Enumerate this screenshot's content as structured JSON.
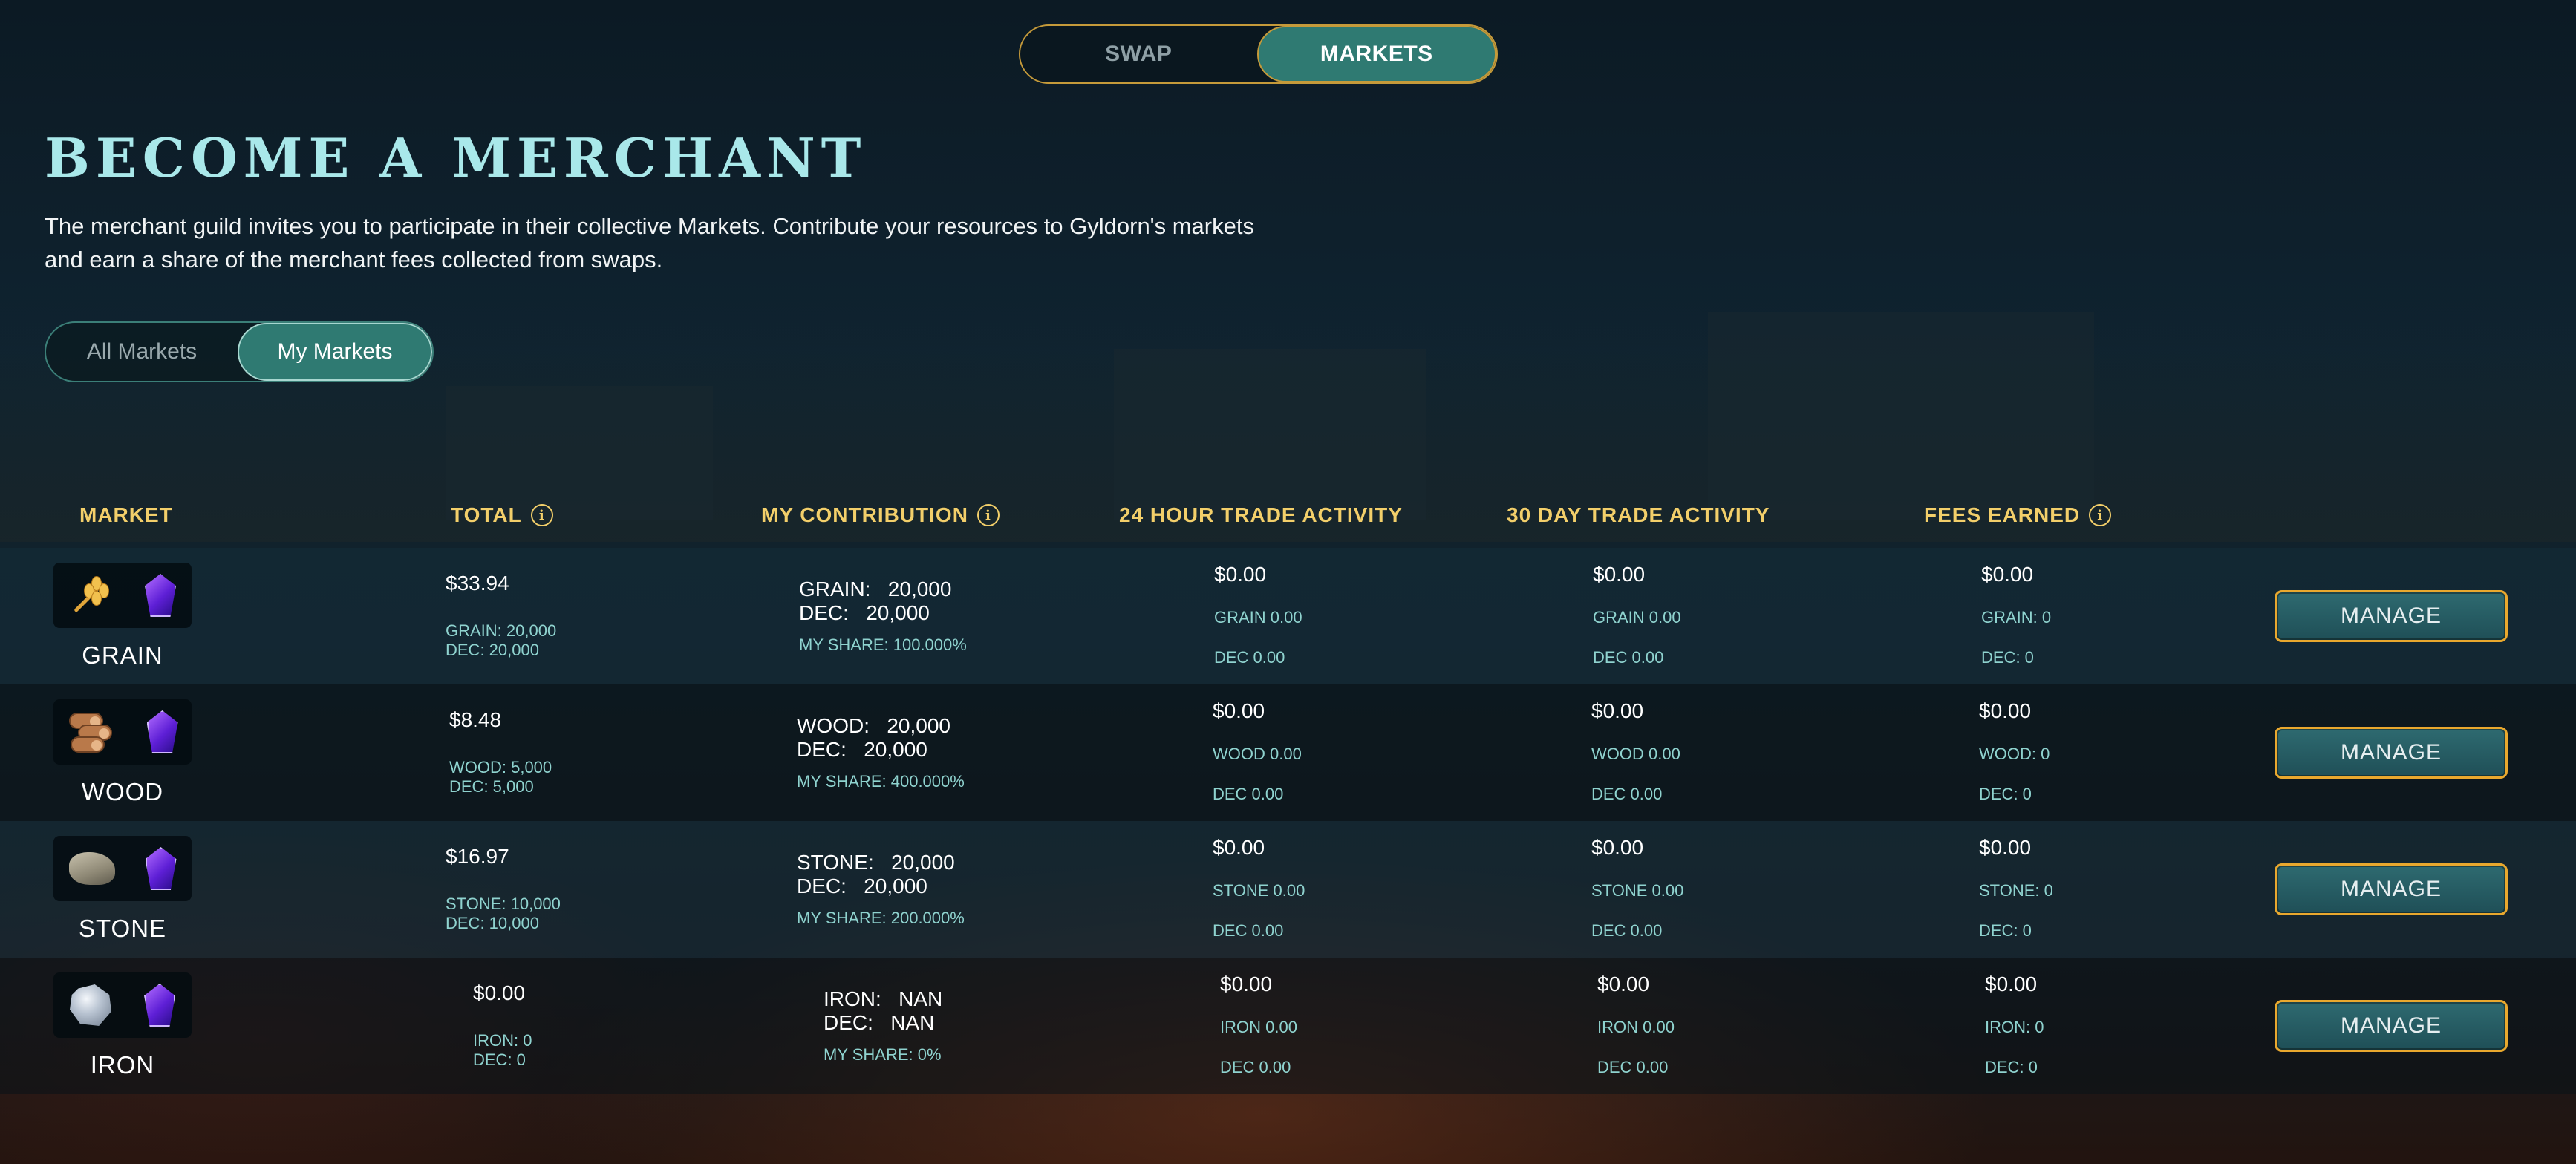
{
  "nav": {
    "tabs": [
      "SWAP",
      "MARKETS"
    ],
    "active": "MARKETS"
  },
  "page": {
    "title": "BECOME A MERCHANT",
    "intro": "The merchant guild invites you to participate in their collective Markets. Contribute your resources to Gyldorn's markets and earn a share of the merchant fees collected from swaps."
  },
  "filter": {
    "tabs": [
      "All Markets",
      "My Markets"
    ],
    "active": "My Markets"
  },
  "table": {
    "headers": {
      "market": "MARKET",
      "total": "TOTAL",
      "contribution": "MY CONTRIBUTION",
      "day24": "24 HOUR TRADE ACTIVITY",
      "day30": "30 DAY TRADE ACTIVITY",
      "fees": "FEES EARNED"
    },
    "info_icon": "i",
    "manage_label": "MANAGE",
    "rows": [
      {
        "name": "GRAIN",
        "icons": [
          "wheat-icon",
          "dec-gem-icon"
        ],
        "total": "$33.94",
        "total_a": "GRAIN: 20,000",
        "total_b": "DEC: 20,000",
        "contrib_a": "GRAIN:   20,000",
        "contrib_b": "DEC:   20,000",
        "share": "MY SHARE: 100.000%",
        "d24": "$0.00",
        "d24_a": "GRAIN 0.00",
        "d24_b": "DEC 0.00",
        "d30": "$0.00",
        "d30_a": "GRAIN 0.00",
        "d30_b": "DEC 0.00",
        "fees": "$0.00",
        "fees_a": "GRAIN: 0",
        "fees_b": "DEC: 0"
      },
      {
        "name": "WOOD",
        "icons": [
          "logs-icon",
          "dec-gem-icon"
        ],
        "total": "$8.48",
        "total_a": "WOOD: 5,000",
        "total_b": "DEC: 5,000",
        "contrib_a": "WOOD:   20,000",
        "contrib_b": "DEC:   20,000",
        "share": "MY SHARE: 400.000%",
        "d24": "$0.00",
        "d24_a": "WOOD 0.00",
        "d24_b": "DEC 0.00",
        "d30": "$0.00",
        "d30_a": "WOOD 0.00",
        "d30_b": "DEC 0.00",
        "fees": "$0.00",
        "fees_a": "WOOD: 0",
        "fees_b": "DEC: 0"
      },
      {
        "name": "STONE",
        "icons": [
          "stone-icon",
          "dec-gem-icon"
        ],
        "total": "$16.97",
        "total_a": "STONE: 10,000",
        "total_b": "DEC: 10,000",
        "contrib_a": "STONE:   20,000",
        "contrib_b": "DEC:   20,000",
        "share": "MY SHARE: 200.000%",
        "d24": "$0.00",
        "d24_a": "STONE 0.00",
        "d24_b": "DEC 0.00",
        "d30": "$0.00",
        "d30_a": "STONE 0.00",
        "d30_b": "DEC 0.00",
        "fees": "$0.00",
        "fees_a": "STONE: 0",
        "fees_b": "DEC: 0"
      },
      {
        "name": "IRON",
        "icons": [
          "iron-ore-icon",
          "dec-gem-icon"
        ],
        "total": "$0.00",
        "total_a": "IRON: 0",
        "total_b": "DEC: 0",
        "contrib_a": "IRON:   NAN",
        "contrib_b": "DEC:   NAN",
        "share": "MY SHARE: 0%",
        "d24": "$0.00",
        "d24_a": "IRON 0.00",
        "d24_b": "DEC 0.00",
        "d30": "$0.00",
        "d30_a": "IRON 0.00",
        "d30_b": "DEC 0.00",
        "fees": "$0.00",
        "fees_a": "IRON: 0",
        "fees_b": "DEC: 0"
      }
    ]
  }
}
